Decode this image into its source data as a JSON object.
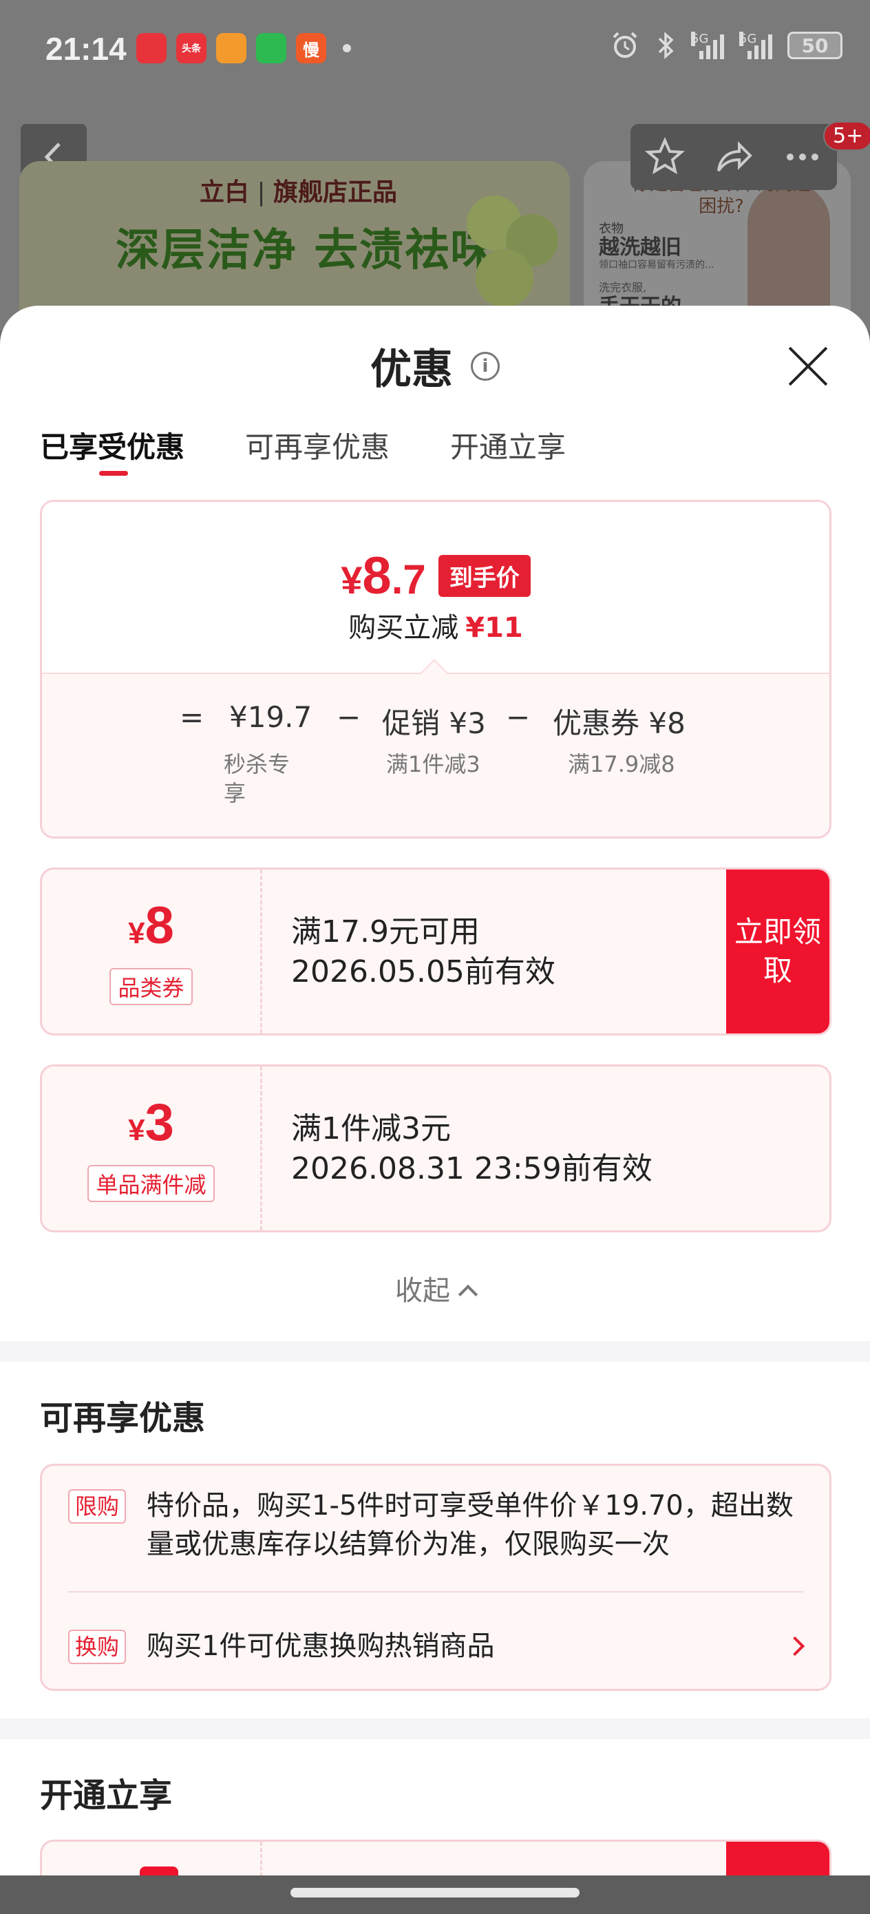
{
  "status_bar": {
    "time": "21:14",
    "apps": [
      {
        "icon": "pdd-app-icon",
        "color": "#e8333a",
        "text": ""
      },
      {
        "icon": "toutiao-app-icon",
        "color": "#e8333a",
        "text": "头条"
      },
      {
        "icon": "tag-app-icon",
        "color": "#f29a2c",
        "text": ""
      },
      {
        "icon": "chat-app-icon",
        "color": "#2cba51",
        "text": ""
      },
      {
        "icon": "manbang-app-icon",
        "color": "#f05a28",
        "text": "慢"
      }
    ],
    "network_1": "5G",
    "network_2": "5G",
    "battery": "50"
  },
  "background_page": {
    "badge_count": "5+",
    "banner_brand": "立白",
    "banner_brand_suffix": "旗舰店正品",
    "banner_slogan": "深层洁净 去渍祛味",
    "side_question": "你是否也为以下的问题困扰?",
    "side_t1": "衣物",
    "side_t2": "越洗越旧",
    "side_t3": "领口袖口容易留有污渍的...",
    "side_t4": "洗完衣服,",
    "side_t5": "手干干的"
  },
  "sheet": {
    "title": "优惠",
    "info_icon": "i",
    "tabs": [
      {
        "label": "已享受优惠",
        "active": true
      },
      {
        "label": "可再享优惠",
        "active": false
      },
      {
        "label": "开通立享",
        "active": false
      }
    ],
    "summary": {
      "final_price_yen": "¥",
      "final_price_int": "8",
      "final_price_dec": ".7",
      "final_tag": "到手价",
      "reduce_label": "购买立减",
      "reduce_amount": "¥11",
      "formula": {
        "equals": "=",
        "base_price": "¥19.7",
        "base_note": "秒杀专享",
        "minus1": "−",
        "promo": "促销 ¥3",
        "promo_note": "满1件减3",
        "minus2": "−",
        "coupon": "优惠券 ¥8",
        "coupon_note": "满17.9减8"
      }
    },
    "coupons": [
      {
        "yen": "¥",
        "amount": "8",
        "type": "品类券",
        "line1": "满17.9元可用",
        "line2": "2026.05.05前有效",
        "button": "立即领取"
      },
      {
        "yen": "¥",
        "amount": "3",
        "type": "单品满件减",
        "line1": "满1件减3元",
        "line2": "2026.08.31 23:59前有效"
      }
    ],
    "collapse_label": "收起",
    "more_section": {
      "title": "可再享优惠",
      "perks": [
        {
          "tag": "限购",
          "text": "特价品，购买1-5件时可享受单件价￥19.70，超出数量或优惠库存以结算价为准，仅限购买一次"
        },
        {
          "tag": "换购",
          "text": "购买1件可优惠换购热销商品"
        }
      ]
    },
    "open_section": {
      "title": "开通立享"
    }
  }
}
